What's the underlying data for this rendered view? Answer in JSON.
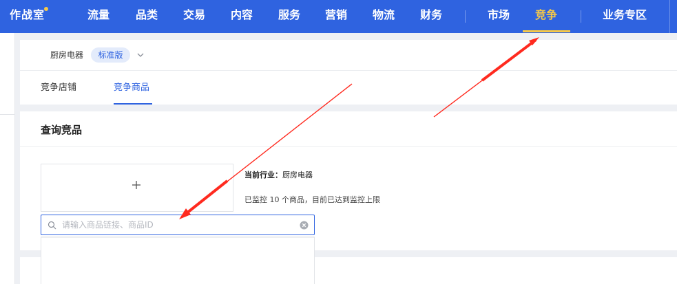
{
  "topnav": {
    "brand": "作战室",
    "items": [
      {
        "label": "流量",
        "active": false
      },
      {
        "label": "品类",
        "active": false
      },
      {
        "label": "交易",
        "active": false
      },
      {
        "label": "内容",
        "active": false
      },
      {
        "label": "服务",
        "active": false
      },
      {
        "label": "营销",
        "active": false
      },
      {
        "label": "物流",
        "active": false
      },
      {
        "label": "财务",
        "active": false
      },
      {
        "label": "市场",
        "active": false
      },
      {
        "label": "竞争",
        "active": true
      },
      {
        "label": "业务专区",
        "active": false
      }
    ]
  },
  "header": {
    "category": "厨房电器",
    "edition": "标准版",
    "tabs": [
      {
        "label": "竞争店铺",
        "active": false
      },
      {
        "label": "竞争商品",
        "active": true
      }
    ]
  },
  "query": {
    "title": "查询竞品",
    "industry_label": "当前行业：",
    "industry_value": "厨房电器",
    "monitor_text": "已监控 10 个商品，目前已达到监控上限"
  },
  "search": {
    "placeholder": "请输入商品链接、商品ID",
    "value": ""
  },
  "colors": {
    "brand_blue": "#2f63e0",
    "active_yellow": "#f7c948",
    "annotation_red": "#ff2a1f"
  },
  "icons": [
    "brand-dot",
    "chevron-down-icon",
    "plus-icon",
    "search-icon",
    "clear-icon"
  ]
}
